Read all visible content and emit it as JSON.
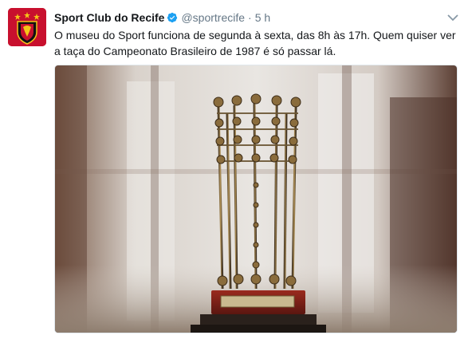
{
  "tweet": {
    "author_name": "Sport Club do Recife",
    "handle": "@sportrecife",
    "separator": "·",
    "time": "5 h",
    "text": "O museu do Sport funciona de segunda à sexta, das 8h às 17h. Quem quiser ver a taça do Campeonato Brasileiro de 1987 é só passar lá.",
    "verified": true,
    "colors": {
      "name": "#14171a",
      "secondary": "#657786",
      "verified_badge": "#1da1f2",
      "avatar_bg": "#c8102e"
    },
    "icons": {
      "verified": "verified-badge-icon",
      "menu": "chevron-down-icon"
    }
  }
}
